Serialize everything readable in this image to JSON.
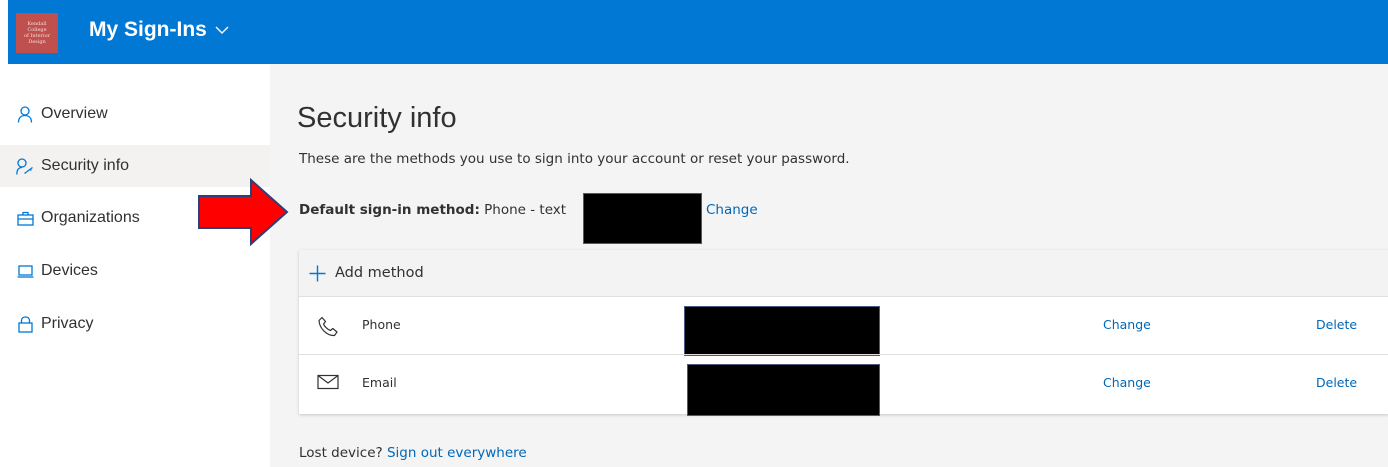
{
  "header": {
    "logo_text": [
      "Kendall",
      "College",
      "of Interior",
      "Design"
    ],
    "app_title": "My Sign-Ins",
    "chevron_icon": "chevron-down-icon",
    "bar_color": "#0078d4"
  },
  "sidebar": {
    "items": [
      {
        "label": "Overview",
        "icon": "person-icon",
        "active": false
      },
      {
        "label": "Security info",
        "icon": "security-person-icon",
        "active": true
      },
      {
        "label": "Organizations",
        "icon": "briefcase-icon",
        "active": false
      },
      {
        "label": "Devices",
        "icon": "laptop-icon",
        "active": false
      },
      {
        "label": "Privacy",
        "icon": "lock-icon",
        "active": false
      }
    ]
  },
  "main": {
    "title": "Security info",
    "subtitle": "These are the methods you use to sign into your account or reset your password.",
    "default_method": {
      "label": "Default sign-in method:",
      "value": "Phone - text",
      "change_label": "Change"
    },
    "add_method_label": "Add method",
    "methods": [
      {
        "name": "Phone",
        "icon": "phone-icon",
        "change_label": "Change",
        "delete_label": "Delete"
      },
      {
        "name": "Email",
        "icon": "envelope-icon",
        "change_label": "Change",
        "delete_label": "Delete"
      }
    ],
    "lost_device": {
      "text": "Lost device?",
      "link": "Sign out everywhere"
    }
  },
  "annotation": {
    "arrow_icon": "red-arrow-icon",
    "arrow_color": "#ff0000"
  },
  "colors": {
    "link": "#0067b8",
    "accent": "#0078d4"
  }
}
